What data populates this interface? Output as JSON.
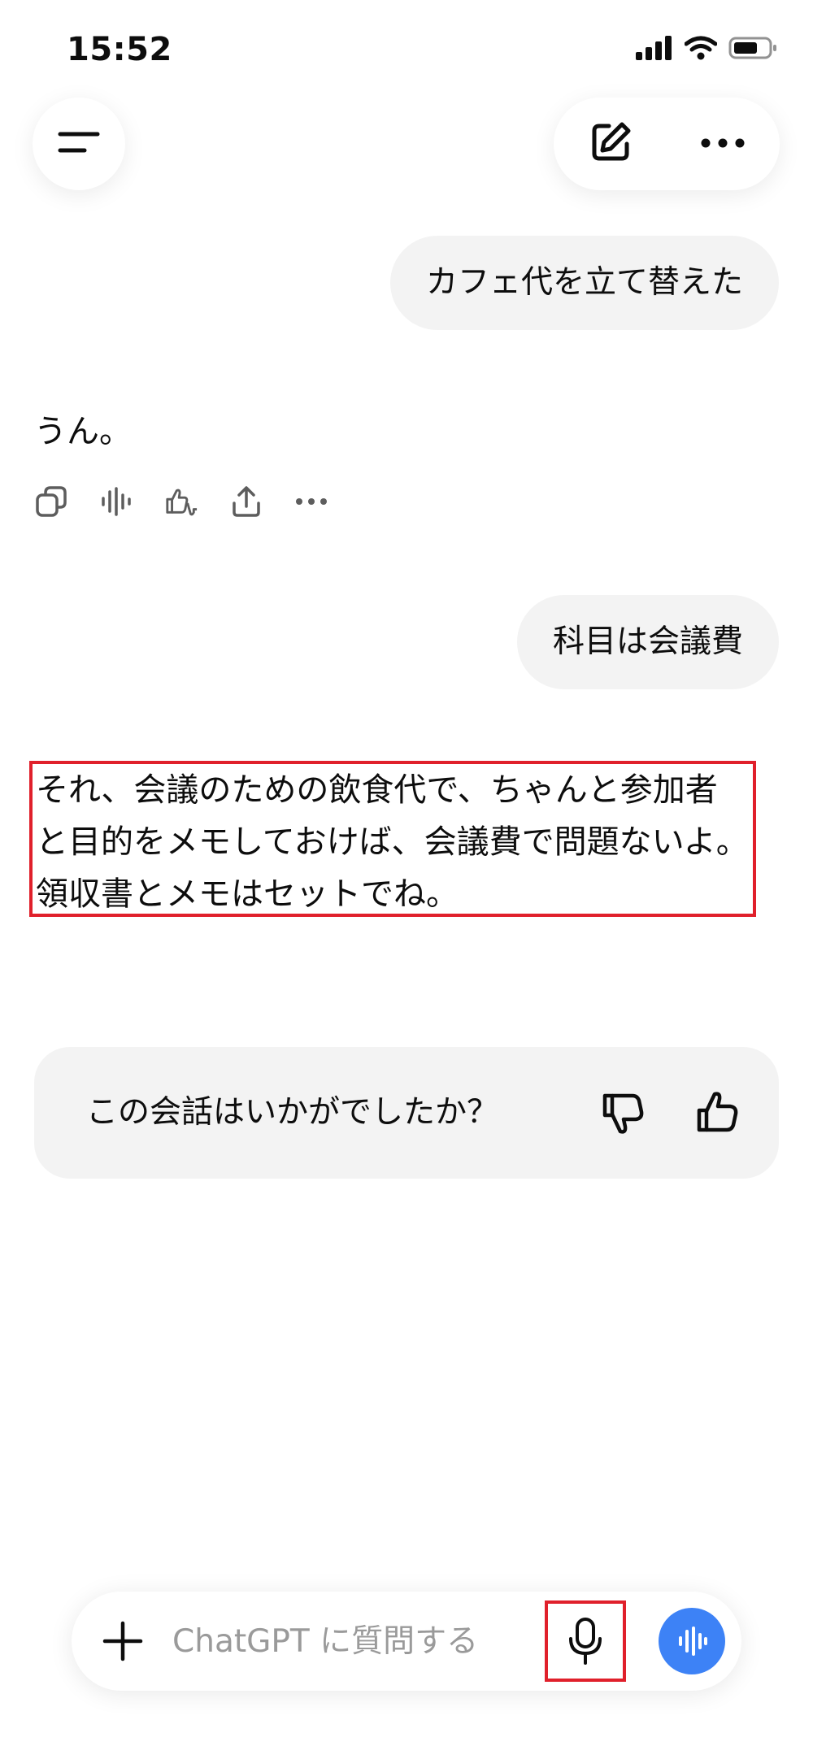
{
  "status_bar": {
    "time": "15:52"
  },
  "icons": {
    "menu": "menu-icon",
    "new_chat": "compose-icon",
    "more": "more-icon",
    "copy": "copy-icon",
    "read_aloud": "speaker-icon",
    "feedback": "thumbs-icon",
    "share": "share-icon",
    "plus": "plus-icon",
    "mic": "microphone-icon",
    "voice": "voice-mode-icon"
  },
  "conversation": {
    "user_message_1": "カフェ代を立て替えた",
    "assistant_message_1": "うん。",
    "user_message_2": "科目は会議費",
    "assistant_message_2": {
      "line_1": "それ、会議のための飲食代で、ちゃんと参加者",
      "line_2": "と目的をメモしておけば、会議費で問題ないよ。",
      "line_3": "領収書とメモはセットでね。"
    }
  },
  "feedback": {
    "prompt": "この会話はいかがでしたか？"
  },
  "composer": {
    "placeholder": "ChatGPT に質問する",
    "value": ""
  },
  "colors": {
    "bubble_bg": "#f3f3f3",
    "accent_blue": "#3d82f6",
    "highlight_red": "#e0202b",
    "text": "#0d0d0d",
    "placeholder": "#9a9a9a"
  }
}
